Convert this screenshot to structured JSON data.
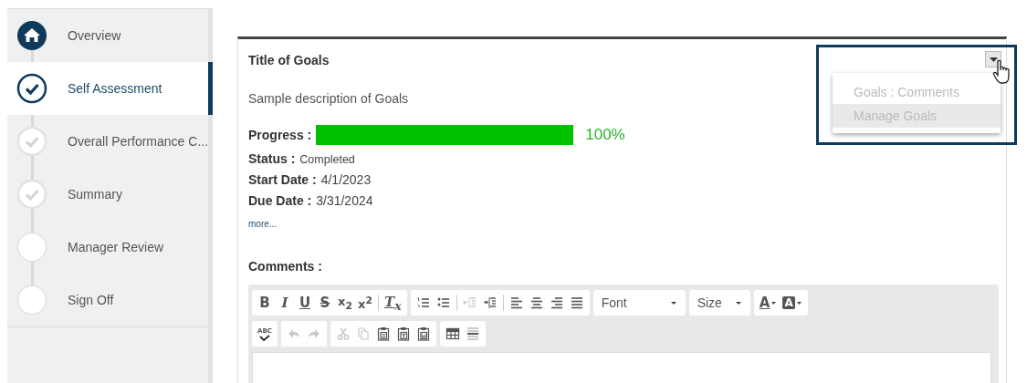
{
  "steps": [
    {
      "label": "Overview",
      "kind": "home",
      "selected": false
    },
    {
      "label": "Self Assessment",
      "kind": "check",
      "selected": true
    },
    {
      "label": "Overall Performance C...",
      "kind": "check",
      "selected": false
    },
    {
      "label": "Summary",
      "kind": "check",
      "selected": false
    },
    {
      "label": "Manager Review",
      "kind": "blank",
      "selected": false
    },
    {
      "label": "Sign Off",
      "kind": "blank",
      "selected": false
    }
  ],
  "goal": {
    "title": "Title of Goals",
    "description": "Sample description of Goals",
    "progress": {
      "label": "Progress :",
      "level": 1,
      "reading": "100%"
    },
    "fields": [
      {
        "label": "Status :",
        "value": "Completed"
      },
      {
        "label": "Start Date :",
        "value": "4/1/2023"
      },
      {
        "label": "Due Date :",
        "value": "3/31/2024"
      }
    ],
    "more": "more...",
    "menu": [
      {
        "label": "Goals : Comments",
        "selected": false
      },
      {
        "label": "Manage Goals",
        "selected": true
      }
    ]
  },
  "comments": {
    "label": "Comments :",
    "toolbar": [
      [
        [
          {
            "kind": "bold",
            "label": "B",
            "disabled": false
          },
          {
            "kind": "italic",
            "label": "I",
            "disabled": false
          },
          {
            "kind": "underline",
            "label": "U",
            "disabled": false
          },
          {
            "kind": "strike",
            "label": "S",
            "disabled": false
          },
          {
            "kind": "subscript",
            "label": "x$_{2}$",
            "disabled": false
          },
          {
            "kind": "superscript",
            "label": "x$^{2}$",
            "disabled": false
          },
          {
            "kind": "sep"
          },
          {
            "kind": "clear",
            "label": "T$_{x}$",
            "disabled": false
          }
        ],
        [
          {
            "kind": "numbered",
            "disabled": false
          },
          {
            "kind": "bulleted",
            "disabled": false
          },
          {
            "kind": "sep"
          },
          {
            "kind": "outdent",
            "disabled": true
          },
          {
            "kind": "indent",
            "disabled": false
          },
          {
            "kind": "sep"
          },
          {
            "kind": "alignleft",
            "disabled": false
          },
          {
            "kind": "aligncenter",
            "disabled": false
          },
          {
            "kind": "alignright",
            "disabled": false
          },
          {
            "kind": "justify",
            "disabled": false
          }
        ],
        [
          {
            "kind": "dropdown",
            "label": "Font",
            "disabled": false
          }
        ],
        [
          {
            "kind": "dropdown",
            "label": "Size",
            "disabled": false
          }
        ],
        [
          {
            "kind": "textcolor",
            "label": "A",
            "disabled": false
          },
          {
            "kind": "bgcolor",
            "label": "A",
            "disabled": false
          }
        ]
      ],
      [
        [
          {
            "kind": "spell",
            "label": "ABC",
            "disabled": false
          }
        ],
        [
          {
            "kind": "undo",
            "disabled": true
          },
          {
            "kind": "redo",
            "disabled": true
          }
        ],
        [
          {
            "kind": "cut",
            "disabled": true
          },
          {
            "kind": "copy",
            "disabled": true
          },
          {
            "kind": "paste",
            "disabled": false
          },
          {
            "kind": "pastetext",
            "disabled": false
          },
          {
            "kind": "pasteword",
            "disabled": false
          }
        ],
        [
          {
            "kind": "table",
            "disabled": false
          },
          {
            "kind": "rule",
            "disabled": false
          }
        ]
      ]
    ]
  }
}
